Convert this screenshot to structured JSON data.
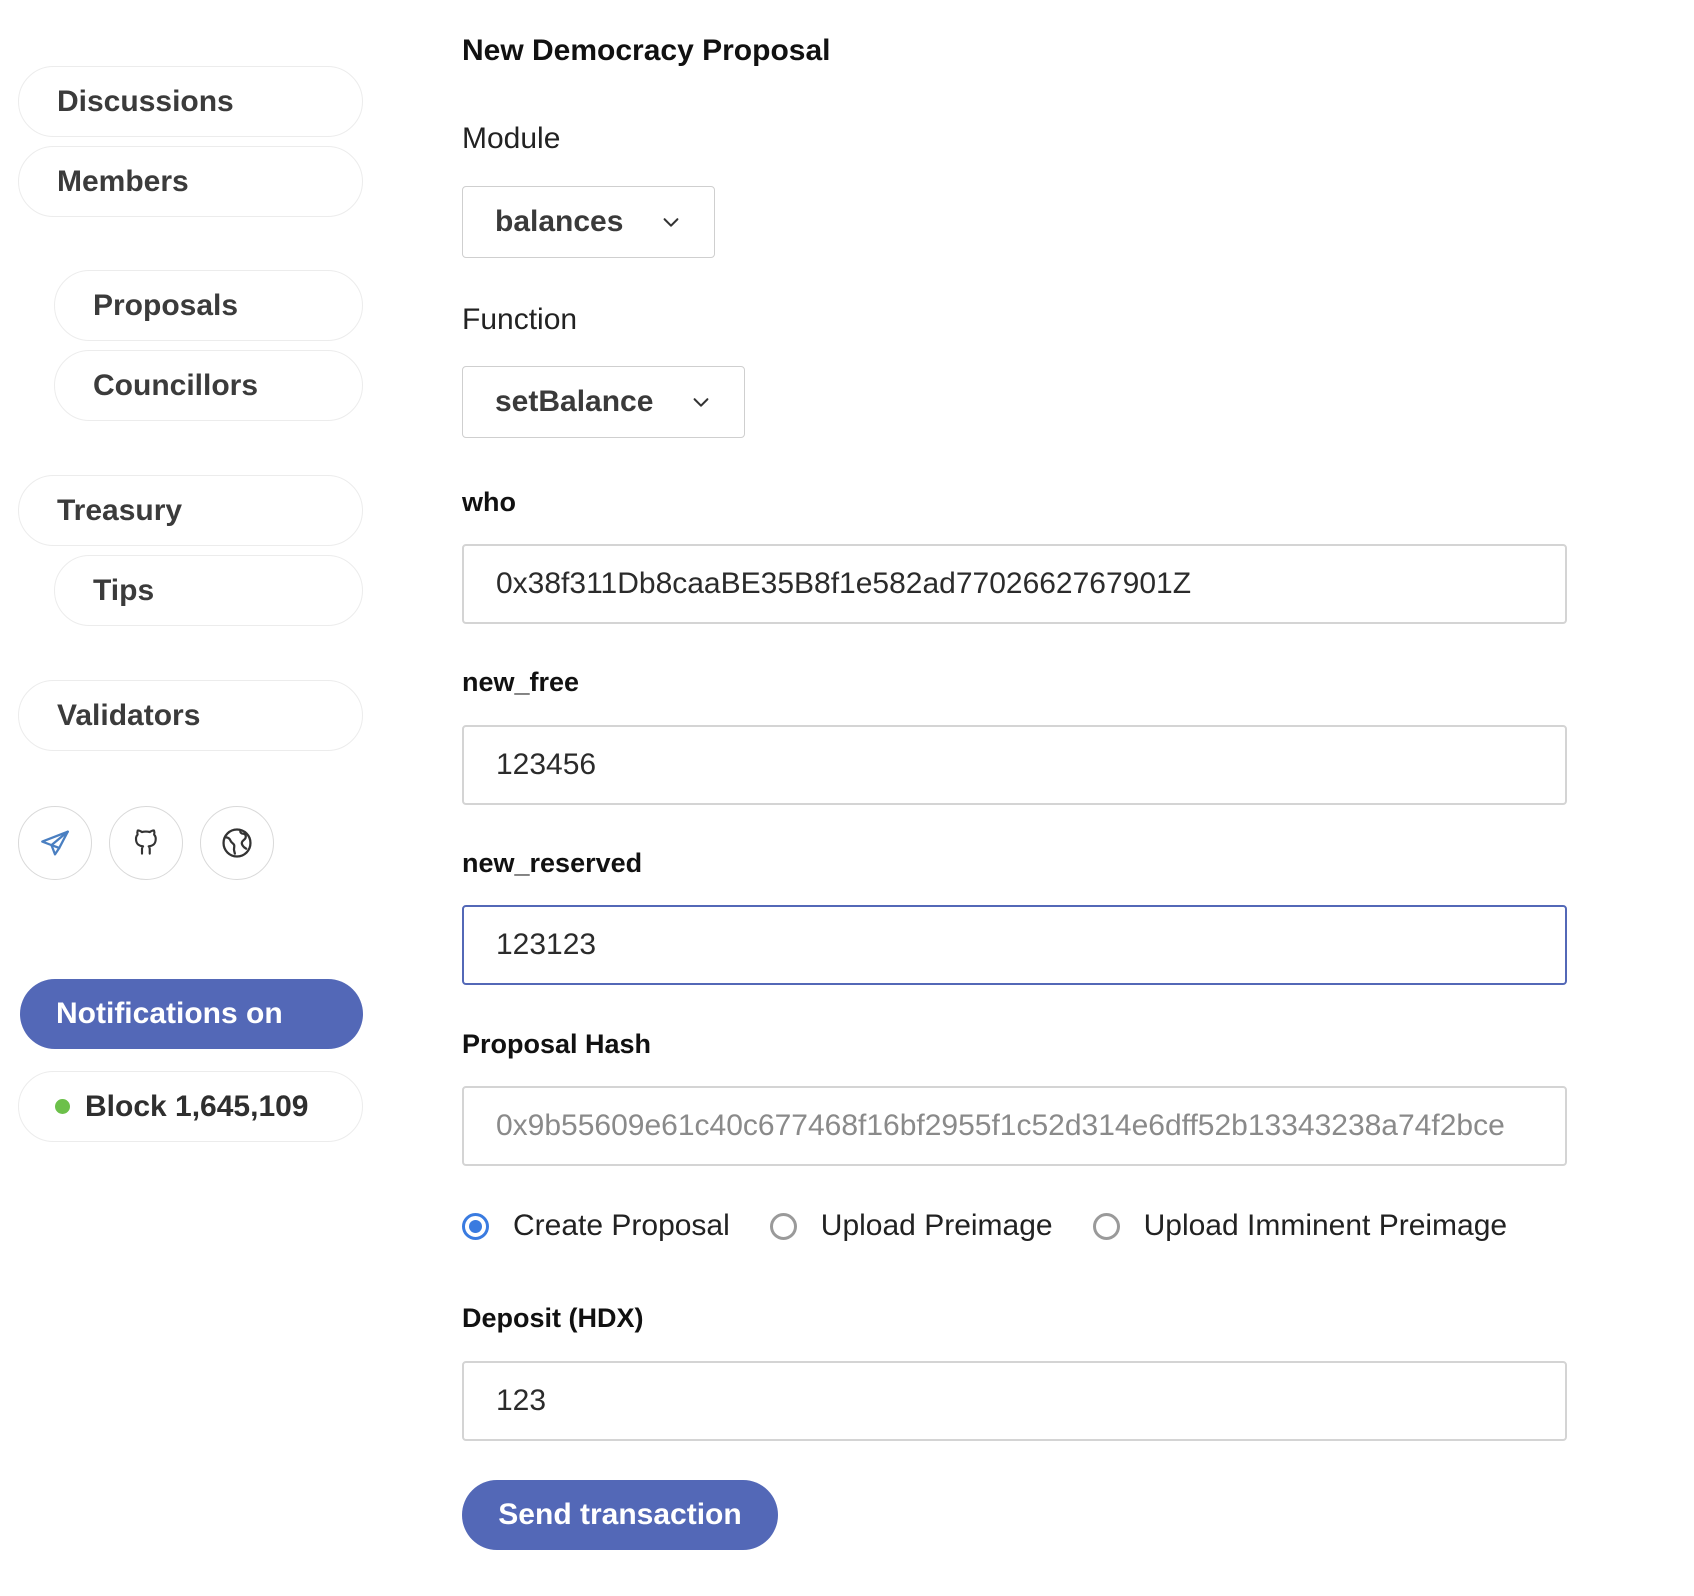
{
  "sidebar": {
    "items": [
      {
        "label": "Discussions"
      },
      {
        "label": "Members"
      },
      {
        "label": "Proposals"
      },
      {
        "label": "Councillors"
      },
      {
        "label": "Treasury"
      },
      {
        "label": "Tips"
      },
      {
        "label": "Validators"
      }
    ],
    "icons": [
      "telegram-icon",
      "github-icon",
      "globe-icon"
    ],
    "notifications_label": "Notifications on",
    "block_label": "Block 1,645,109",
    "status_color": "#6cc04a"
  },
  "form": {
    "title": "New Democracy Proposal",
    "module_label": "Module",
    "module_value": "balances",
    "function_label": "Function",
    "function_value": "setBalance",
    "who_label": "who",
    "who_value": "0x38f311Db8caaBE35B8f1e582ad7702662767901Z",
    "new_free_label": "new_free",
    "new_free_value": "123456",
    "new_reserved_label": "new_reserved",
    "new_reserved_value": "123123",
    "proposal_hash_label": "Proposal Hash",
    "proposal_hash_value": "0x9b55609e61c40c677468f16bf2955f1c52d314e6dff52b13343238a74f2bce",
    "radio_options": [
      {
        "label": "Create Proposal",
        "selected": true
      },
      {
        "label": "Upload Preimage",
        "selected": false
      },
      {
        "label": "Upload Imminent Preimage",
        "selected": false
      }
    ],
    "deposit_label": "Deposit (HDX)",
    "deposit_value": "123",
    "send_label": "Send transaction"
  },
  "colors": {
    "accent": "#5368b7",
    "radio_selected": "#3a7be0"
  }
}
